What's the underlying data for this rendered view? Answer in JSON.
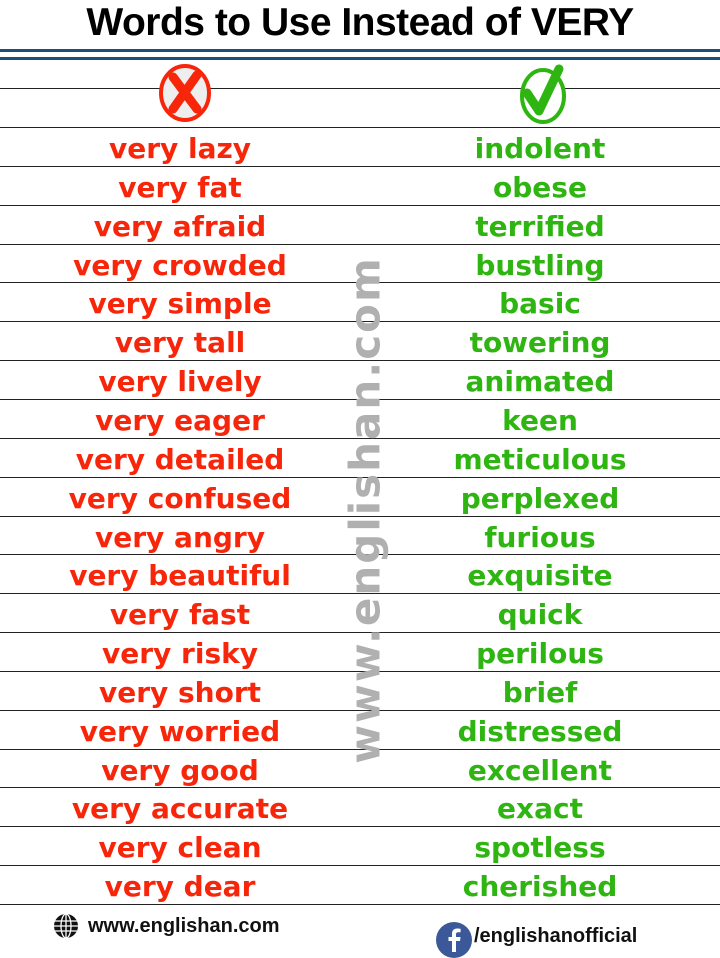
{
  "title": "Words to Use Instead of VERY",
  "header": {
    "wrong_icon": "red-cross-icon",
    "right_icon": "green-check-icon"
  },
  "watermark": "www.englishan.com",
  "colors": {
    "wrong": "#f7260a",
    "right": "#2fb511",
    "rule": "#1f4e79"
  },
  "rows": [
    {
      "very": "very lazy",
      "instead": "indolent"
    },
    {
      "very": "very fat",
      "instead": "obese"
    },
    {
      "very": "very afraid",
      "instead": "terrified"
    },
    {
      "very": "very crowded",
      "instead": "bustling"
    },
    {
      "very": "very simple",
      "instead": "basic"
    },
    {
      "very": "very tall",
      "instead": "towering"
    },
    {
      "very": "very lively",
      "instead": "animated"
    },
    {
      "very": "very eager",
      "instead": "keen"
    },
    {
      "very": "very detailed",
      "instead": "meticulous"
    },
    {
      "very": "very confused",
      "instead": "perplexed"
    },
    {
      "very": "very angry",
      "instead": "furious"
    },
    {
      "very": "very beautiful",
      "instead": "exquisite"
    },
    {
      "very": "very fast",
      "instead": "quick"
    },
    {
      "very": "very risky",
      "instead": "perilous"
    },
    {
      "very": "very short",
      "instead": "brief"
    },
    {
      "very": "very worried",
      "instead": "distressed"
    },
    {
      "very": "very good",
      "instead": "excellent"
    },
    {
      "very": "very accurate",
      "instead": "exact"
    },
    {
      "very": "very clean",
      "instead": "spotless"
    },
    {
      "very": "very dear",
      "instead": "cherished"
    }
  ],
  "footer": {
    "website": "www.englishan.com",
    "facebook": "/englishanofficial"
  }
}
